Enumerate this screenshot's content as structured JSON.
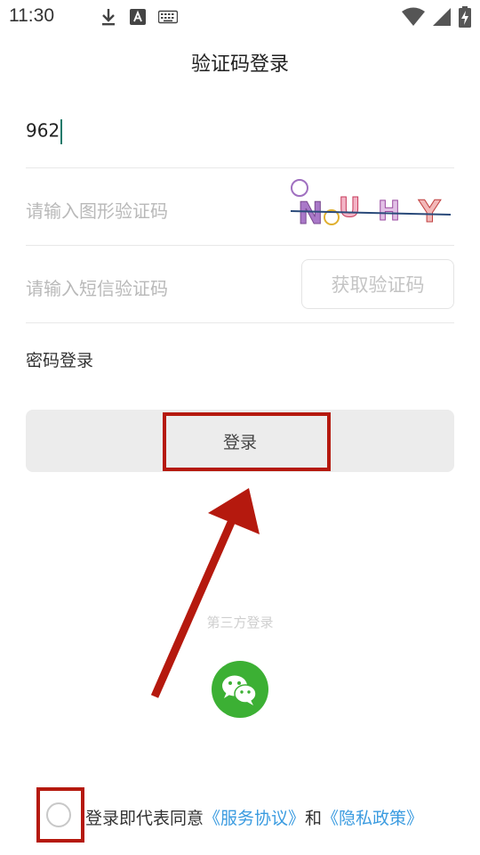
{
  "status_bar": {
    "time": "11:30",
    "left_icons": [
      "download-icon",
      "font-a-icon",
      "keyboard-icon"
    ],
    "right_icons": [
      "wifi-icon",
      "signal-icon",
      "battery-charging-icon"
    ]
  },
  "header": {
    "title": "验证码登录"
  },
  "form": {
    "phone_value": "962",
    "captcha_placeholder": "请输入图形验证码",
    "captcha_text": "NUHY",
    "sms_placeholder": "请输入短信验证码",
    "sms_button_label": "获取验证码",
    "password_login_label": "密码登录",
    "login_button_label": "登录"
  },
  "third_party": {
    "label": "第三方登录",
    "wechat_icon": "wechat-icon"
  },
  "agreement": {
    "prefix": "登录即代表同意",
    "service_link": "《服务协议》",
    "conjunction": "和",
    "privacy_link": "《隐私政策》"
  },
  "colors": {
    "annotation_red": "#b5190e",
    "wechat_green": "#3cb034",
    "link_blue": "#3a9be0",
    "cursor_teal": "#1a7a6a"
  }
}
